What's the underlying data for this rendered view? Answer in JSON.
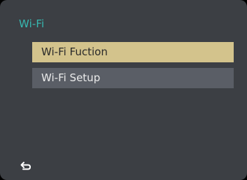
{
  "screen": {
    "title": "Wi-Fi"
  },
  "menu": {
    "items": [
      {
        "label": "Wi-Fi Fuction",
        "selected": true
      },
      {
        "label": "Wi-Fi Setup",
        "selected": false
      }
    ]
  },
  "footer": {
    "back_icon": "return-arrow-icon"
  },
  "colors": {
    "background": "#3c3f44",
    "title": "#37b8b1",
    "selected_item_bg": "#d3c38c",
    "item_bg": "#5a5e66"
  }
}
